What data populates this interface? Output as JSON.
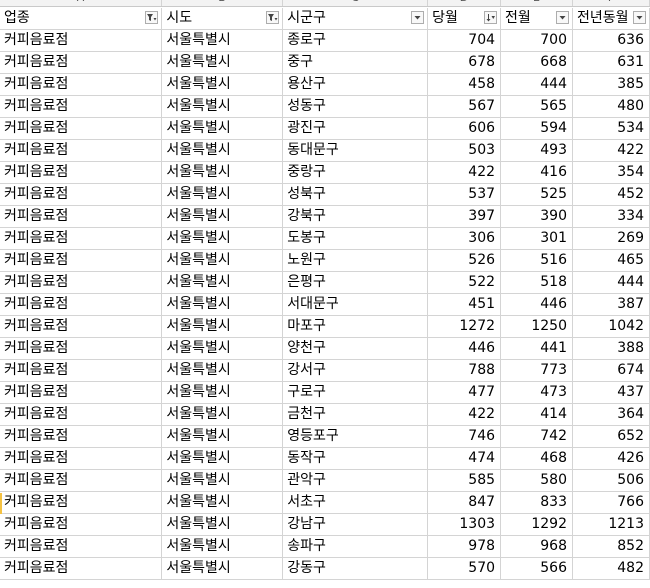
{
  "columns": [
    {
      "letter": "A",
      "label": "업종",
      "filter": "filtered"
    },
    {
      "letter": "B",
      "label": "시도",
      "filter": "filtered"
    },
    {
      "letter": "C",
      "label": "시군구",
      "filter": "dropdown"
    },
    {
      "letter": "D",
      "label": "당월",
      "filter": "sort-desc"
    },
    {
      "letter": "E",
      "label": "전월",
      "filter": "dropdown"
    },
    {
      "letter": "F",
      "label": "전년동월",
      "filter": "dropdown"
    }
  ],
  "rows": [
    [
      "커피음료점",
      "서울특별시",
      "종로구",
      "704",
      "700",
      "636"
    ],
    [
      "커피음료점",
      "서울특별시",
      "중구",
      "678",
      "668",
      "631"
    ],
    [
      "커피음료점",
      "서울특별시",
      "용산구",
      "458",
      "444",
      "385"
    ],
    [
      "커피음료점",
      "서울특별시",
      "성동구",
      "567",
      "565",
      "480"
    ],
    [
      "커피음료점",
      "서울특별시",
      "광진구",
      "606",
      "594",
      "534"
    ],
    [
      "커피음료점",
      "서울특별시",
      "동대문구",
      "503",
      "493",
      "422"
    ],
    [
      "커피음료점",
      "서울특별시",
      "중랑구",
      "422",
      "416",
      "354"
    ],
    [
      "커피음료점",
      "서울특별시",
      "성북구",
      "537",
      "525",
      "452"
    ],
    [
      "커피음료점",
      "서울특별시",
      "강북구",
      "397",
      "390",
      "334"
    ],
    [
      "커피음료점",
      "서울특별시",
      "도봉구",
      "306",
      "301",
      "269"
    ],
    [
      "커피음료점",
      "서울특별시",
      "노원구",
      "526",
      "516",
      "465"
    ],
    [
      "커피음료점",
      "서울특별시",
      "은평구",
      "522",
      "518",
      "444"
    ],
    [
      "커피음료점",
      "서울특별시",
      "서대문구",
      "451",
      "446",
      "387"
    ],
    [
      "커피음료점",
      "서울특별시",
      "마포구",
      "1272",
      "1250",
      "1042"
    ],
    [
      "커피음료점",
      "서울특별시",
      "양천구",
      "446",
      "441",
      "388"
    ],
    [
      "커피음료점",
      "서울특별시",
      "강서구",
      "788",
      "773",
      "674"
    ],
    [
      "커피음료점",
      "서울특별시",
      "구로구",
      "477",
      "473",
      "437"
    ],
    [
      "커피음료점",
      "서울특별시",
      "금천구",
      "422",
      "414",
      "364"
    ],
    [
      "커피음료점",
      "서울특별시",
      "영등포구",
      "746",
      "742",
      "652"
    ],
    [
      "커피음료점",
      "서울특별시",
      "동작구",
      "474",
      "468",
      "426"
    ],
    [
      "커피음료점",
      "서울특별시",
      "관악구",
      "585",
      "580",
      "506"
    ],
    [
      "커피음료점",
      "서울특별시",
      "서초구",
      "847",
      "833",
      "766"
    ],
    [
      "커피음료점",
      "서울특별시",
      "강남구",
      "1303",
      "1292",
      "1213"
    ],
    [
      "커피음료점",
      "서울특별시",
      "송파구",
      "978",
      "968",
      "852"
    ],
    [
      "커피음료점",
      "서울특별시",
      "강동구",
      "570",
      "566",
      "482"
    ]
  ]
}
